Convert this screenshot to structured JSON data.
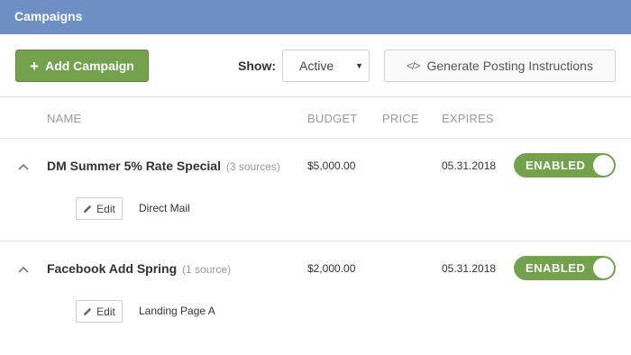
{
  "header": {
    "title": "Campaigns"
  },
  "toolbar": {
    "add_campaign_label": "Add Campaign",
    "show_label": "Show:",
    "show_selected": "Active",
    "generate_label": "Generate Posting Instructions"
  },
  "columns": {
    "name": "NAME",
    "budget": "BUDGET",
    "price": "PRICE",
    "expires": "EXPIRES"
  },
  "campaigns": [
    {
      "name": "DM Summer 5% Rate Special",
      "sources_count": "(3 sources)",
      "budget": "$5,000.00",
      "price": "",
      "expires": "05.31.2018",
      "status": "ENABLED",
      "edit_label": "Edit",
      "source": "Direct Mail"
    },
    {
      "name": "Facebook Add Spring",
      "sources_count": "(1 source)",
      "budget": "$2,000.00",
      "price": "",
      "expires": "05.31.2018",
      "status": "ENABLED",
      "edit_label": "Edit",
      "source": "Landing Page A"
    }
  ],
  "colors": {
    "header": "#6e8fc4",
    "accent_green": "#74a14c"
  },
  "icons": {
    "add": "plus-icon",
    "generate": "code-icon",
    "collapse": "chevron-up-icon",
    "edit": "pencil-icon",
    "dropdown": "caret-down-icon"
  }
}
